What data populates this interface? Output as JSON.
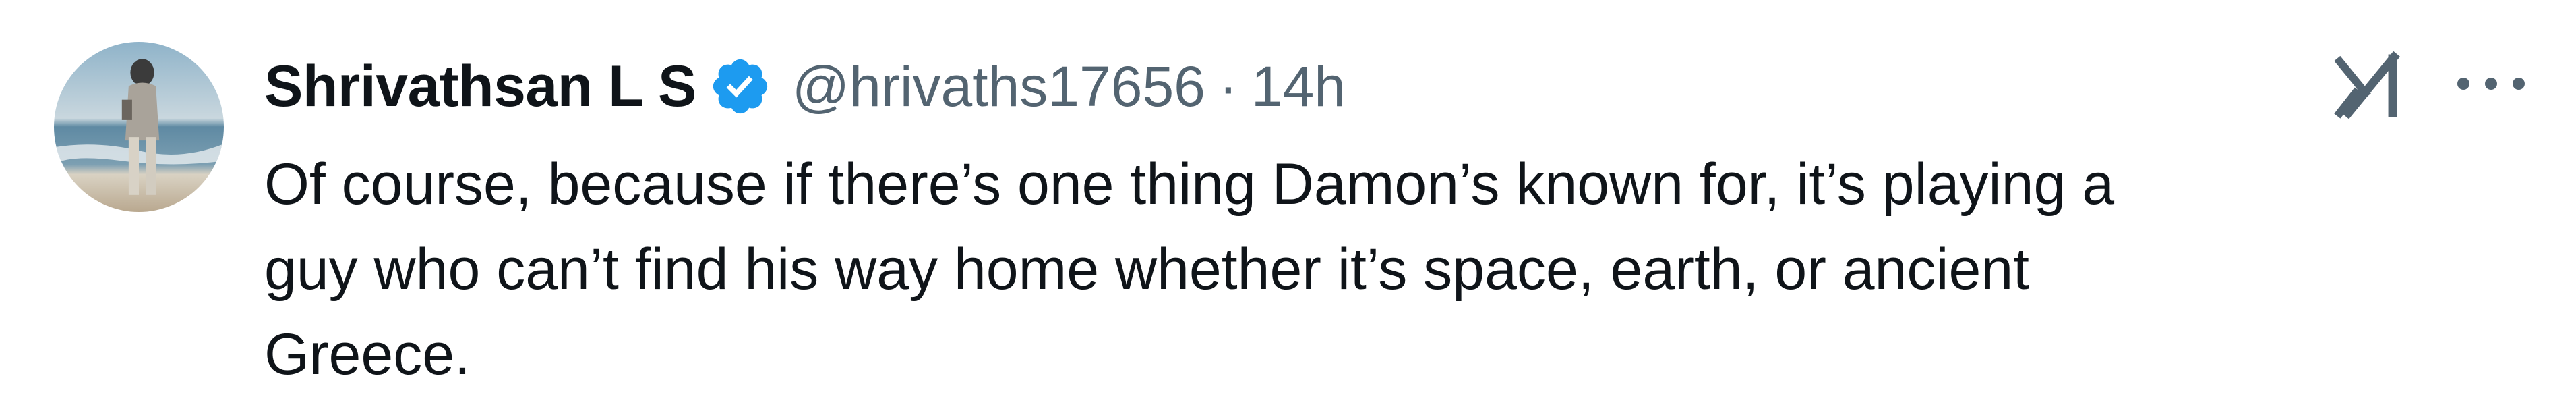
{
  "author": {
    "display_name": "Shrivathsan L S",
    "handle": "@hrivaths17656",
    "separator": "·",
    "timestamp": "14h",
    "verified": true,
    "verified_color": "#1d9bf0"
  },
  "tweet": {
    "lines": [
      "Of course, because if there’s one thing Damon’s known for, it’s playing a",
      "guy who can’t find his way home whether it’s space, earth, or ancient",
      "Greece."
    ]
  },
  "icons": {
    "grok": "grok-icon",
    "more": "more-options-icon",
    "verified": "verified-badge-icon"
  },
  "colors": {
    "text_primary": "#0f1419",
    "text_secondary": "#536471",
    "accent": "#1d9bf0"
  }
}
